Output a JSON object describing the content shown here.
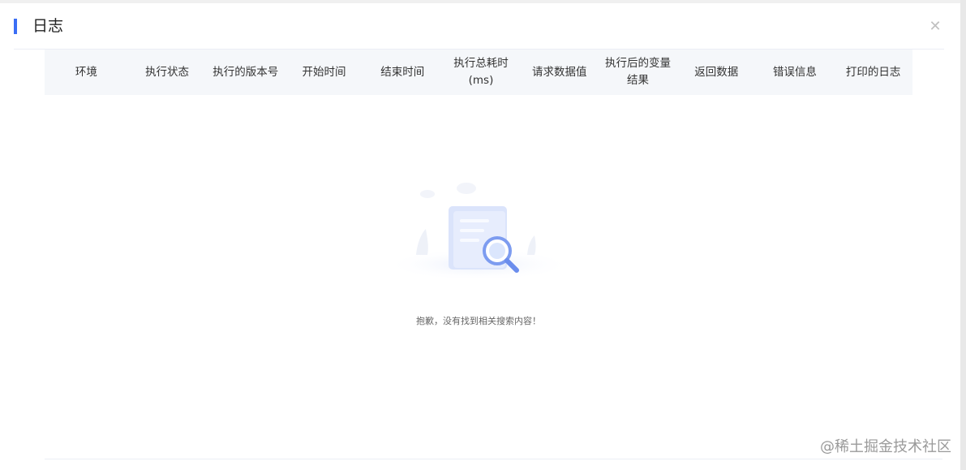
{
  "dialog": {
    "title": "日志",
    "close_icon": "close-icon"
  },
  "table": {
    "columns": [
      "环境",
      "执行状态",
      "执行的版本号",
      "开始时间",
      "结束时间",
      "执行总耗时(ms)",
      "请求数据值",
      "执行后的变量结果",
      "返回数据",
      "错误信息",
      "打印的日志"
    ],
    "rows": []
  },
  "empty_state": {
    "icon": "search-document-illustration",
    "message": "抱歉，没有找到相关搜索内容！"
  },
  "watermark": "@稀土掘金技术社区",
  "colors": {
    "accent": "#3b6ef5",
    "header_bg": "#f5f7fa"
  }
}
